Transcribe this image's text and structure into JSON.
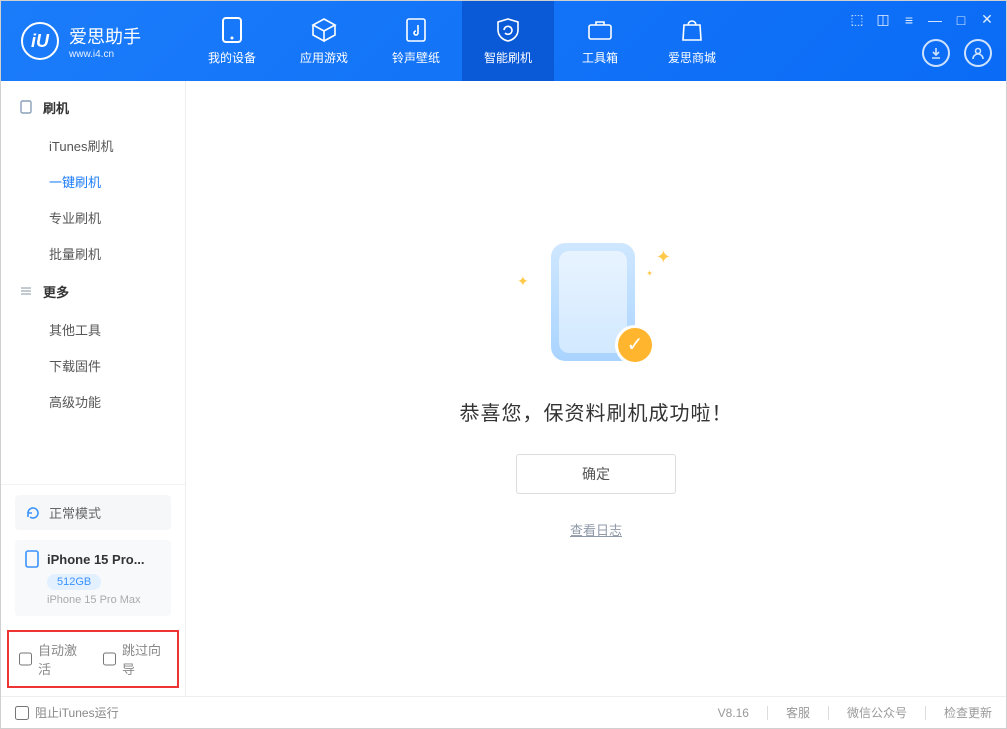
{
  "app": {
    "title": "爱思助手",
    "subtitle": "www.i4.cn"
  },
  "nav": [
    {
      "label": "我的设备"
    },
    {
      "label": "应用游戏"
    },
    {
      "label": "铃声壁纸"
    },
    {
      "label": "智能刷机",
      "active": true
    },
    {
      "label": "工具箱"
    },
    {
      "label": "爱思商城"
    }
  ],
  "sidebar": {
    "group1": {
      "title": "刷机",
      "items": [
        {
          "label": "iTunes刷机"
        },
        {
          "label": "一键刷机",
          "active": true
        },
        {
          "label": "专业刷机"
        },
        {
          "label": "批量刷机"
        }
      ]
    },
    "group2": {
      "title": "更多",
      "items": [
        {
          "label": "其他工具"
        },
        {
          "label": "下载固件"
        },
        {
          "label": "高级功能"
        }
      ]
    },
    "mode_label": "正常模式",
    "device": {
      "name": "iPhone 15 Pro...",
      "storage": "512GB",
      "model": "iPhone 15 Pro Max"
    },
    "checkbox_auto_activate": "自动激活",
    "checkbox_skip_guide": "跳过向导"
  },
  "main": {
    "success_text": "恭喜您，保资料刷机成功啦！",
    "confirm_button": "确定",
    "view_log": "查看日志"
  },
  "statusbar": {
    "block_itunes": "阻止iTunes运行",
    "version": "V8.16",
    "support": "客服",
    "wechat": "微信公众号",
    "check_update": "检查更新"
  }
}
